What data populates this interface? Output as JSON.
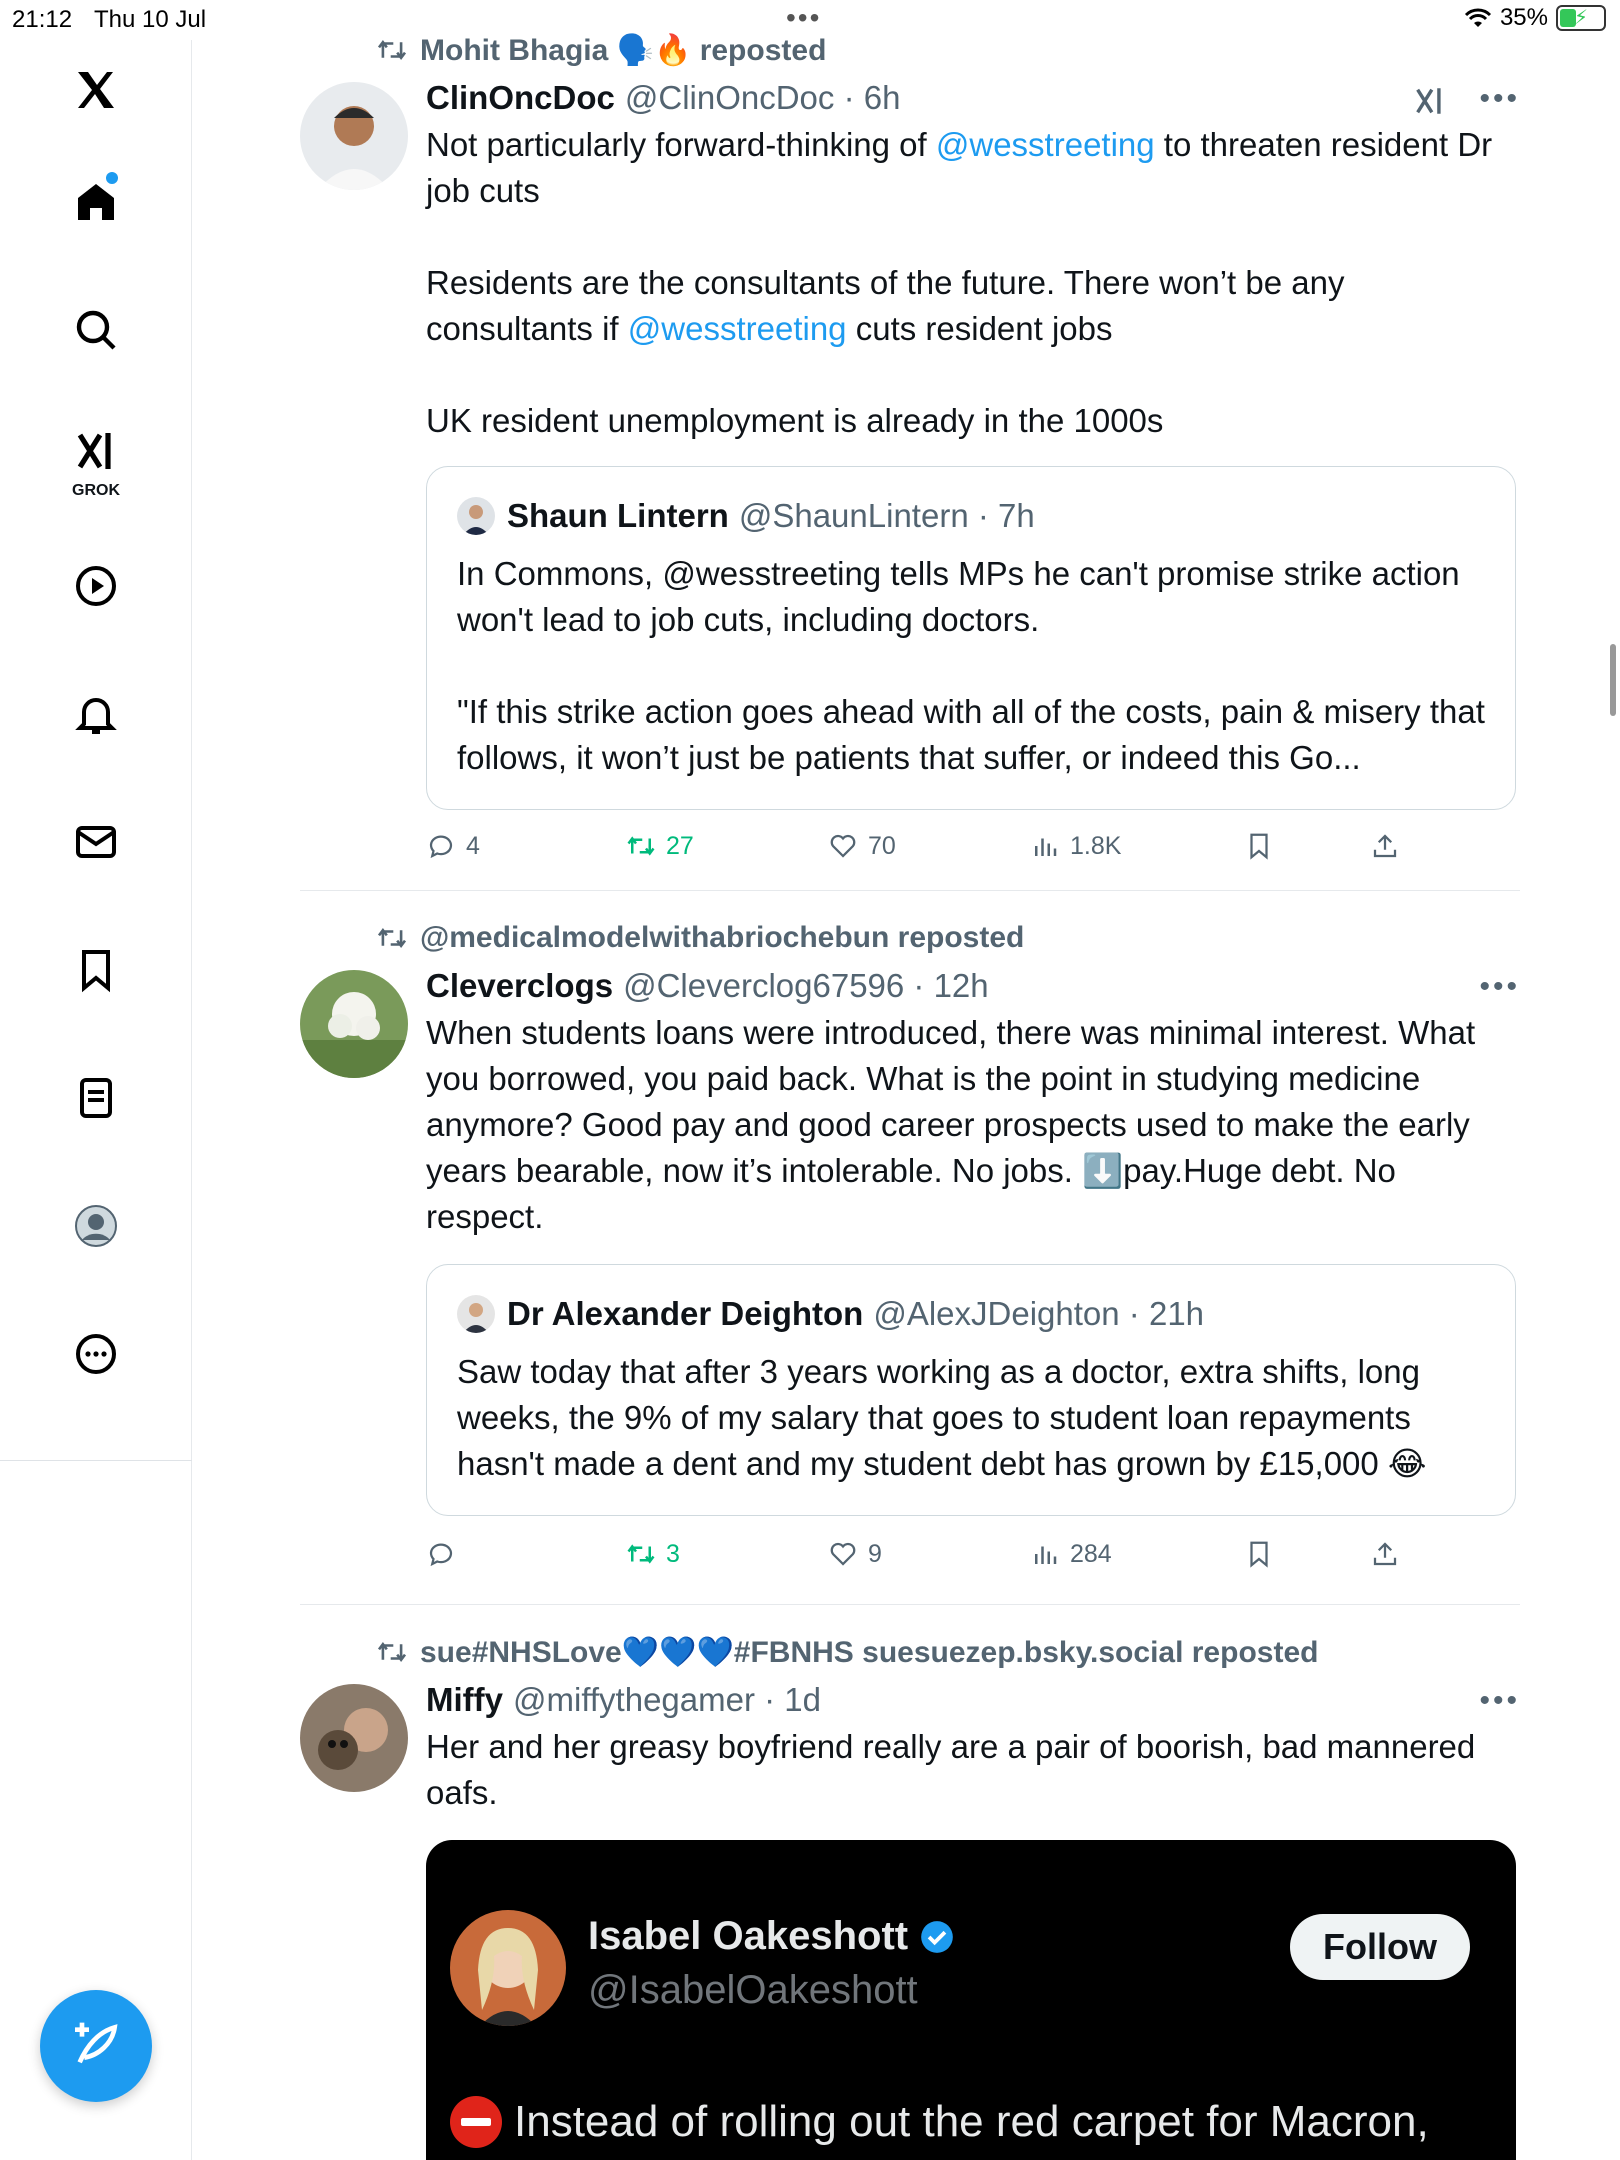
{
  "status_bar": {
    "time": "21:12",
    "date": "Thu 10 Jul",
    "battery": "35%"
  },
  "sidebar": {
    "grok_label": "GROK",
    "items": [
      "X",
      "Home",
      "Search",
      "Grok",
      "Videos",
      "Notifications",
      "Messages",
      "Bookmarks",
      "Lists",
      "Profile",
      "More"
    ]
  },
  "posts": [
    {
      "repost_by": "Mohit Bhagia 🗣️🔥 reposted",
      "author": "ClinOncDoc",
      "handle": "@ClinOncDoc · 6h",
      "body_p1": "Not particularly forward-thinking of ",
      "body_mention1": "@wesstreeting",
      "body_p2": " to threaten resident Dr job cuts\n\nResidents are the consultants of the future. There won’t be any consultants if ",
      "body_mention2": "@wesstreeting",
      "body_p3": " cuts resident jobs\n\nUK resident unemployment is already in the 1000s",
      "quote": {
        "author": "Shaun Lintern",
        "handle": "@ShaunLintern · 7h",
        "text": "In Commons, @wesstreeting tells MPs he can't promise strike action won't lead to job cuts, including doctors.\n\n\"If this strike action goes ahead with all of the costs, pain & misery that follows, it won’t just be patients that suffer, or indeed this Go..."
      },
      "stats": {
        "replies": "4",
        "reposts": "27",
        "likes": "70",
        "views": "1.8K"
      }
    },
    {
      "repost_by": "@medicalmodelwithabriochebun reposted",
      "author": "Cleverclogs",
      "handle": "@Cleverclog67596 · 12h",
      "body": "When students loans were introduced, there was minimal interest. What you borrowed, you paid back. What is the point in studying medicine anymore? Good pay and good career prospects used to make the early years bearable, now it’s intolerable. No jobs. ⬇️pay.Huge debt. No respect.",
      "quote": {
        "author": "Dr Alexander Deighton",
        "handle": "@AlexJDeighton · 21h",
        "text": "Saw today that after 3 years working as a doctor, extra shifts, long weeks, the 9% of my salary that goes to student loan repayments hasn't made a dent and my student debt has grown by £15,000 😂"
      },
      "stats": {
        "replies": "",
        "reposts": "3",
        "likes": "9",
        "views": "284"
      }
    },
    {
      "repost_by": "sue#NHSLove💙💙💙#FBNHS suesuezep.bsky.social reposted",
      "author": "Miffy",
      "handle": "@miffythegamer · 1d",
      "body": "Her and her greasy boyfriend really are a pair of boorish, bad mannered oafs.",
      "embed": {
        "name": "Isabel Oakeshott",
        "handle": "@IsabelOakeshott",
        "follow_label": "Follow",
        "text": "Instead of rolling out the red carpet for Macron,"
      }
    }
  ],
  "colors": {
    "accent": "#1d9bf0",
    "repost_green": "#00ba7c",
    "muted": "#536471"
  },
  "icons": [
    "x-logo-icon",
    "home-icon",
    "search-icon",
    "grok-icon",
    "play-icon",
    "bell-icon",
    "mail-icon",
    "bookmark-icon",
    "list-icon",
    "profile-icon",
    "more-icon",
    "compose-icon",
    "retweet-icon",
    "reply-icon",
    "like-icon",
    "views-icon",
    "share-icon",
    "verified-icon"
  ]
}
